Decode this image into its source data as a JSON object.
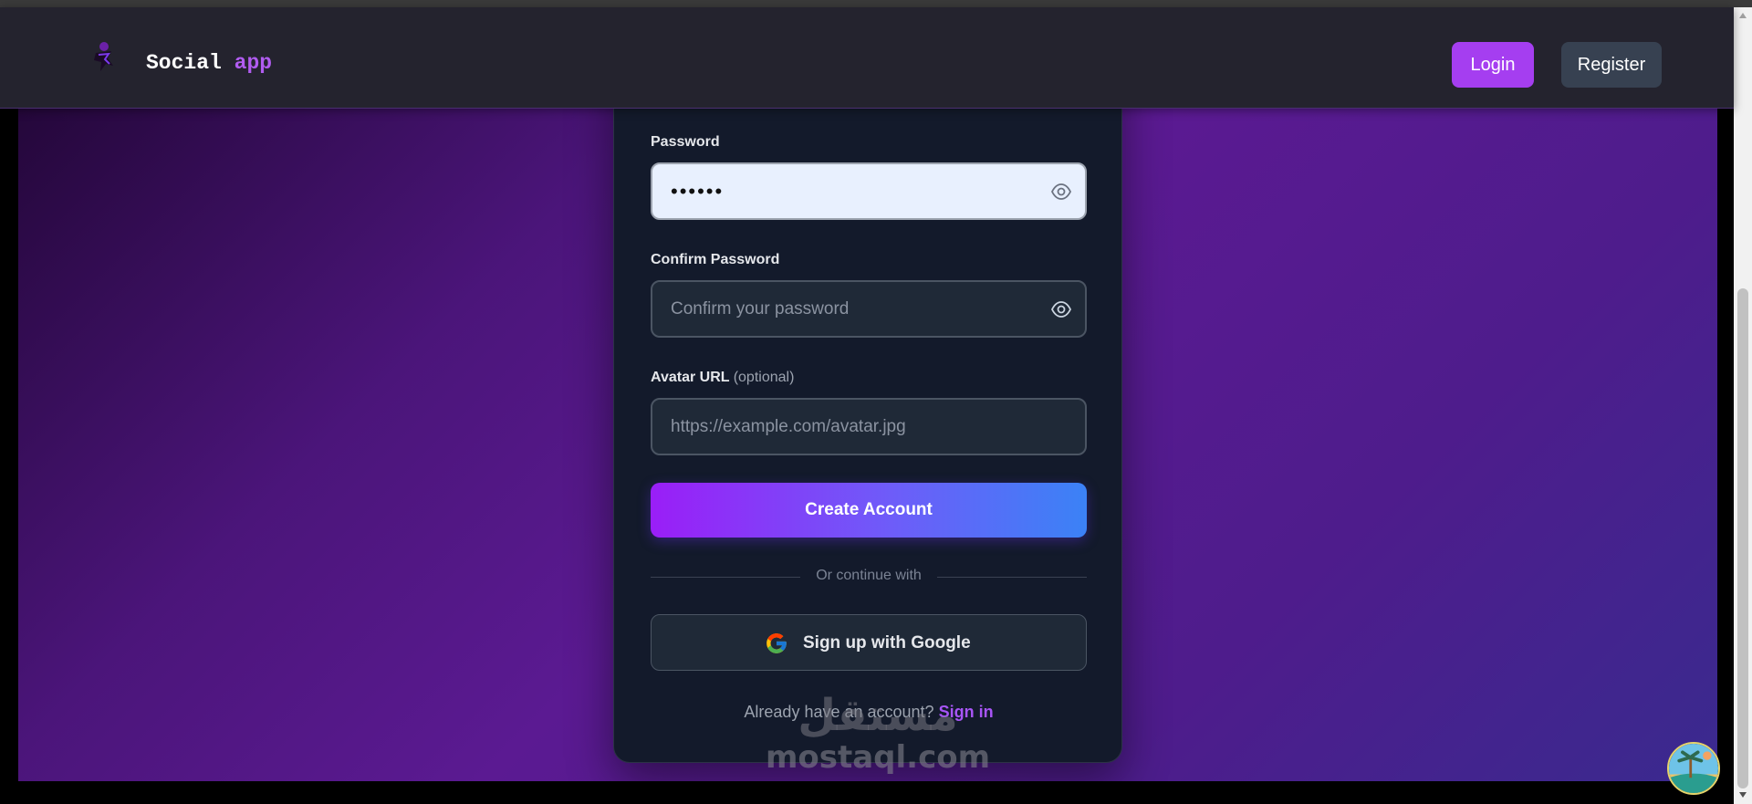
{
  "nav": {
    "brand_main": "Social",
    "brand_accent": "app",
    "login_label": "Login",
    "register_label": "Register"
  },
  "form": {
    "password": {
      "label": "Password",
      "value": "••••••"
    },
    "confirm_password": {
      "label": "Confirm Password",
      "placeholder": "Confirm your password",
      "value": ""
    },
    "avatar_url": {
      "label": "Avatar URL",
      "optional_note": "(optional)",
      "placeholder": "https://example.com/avatar.jpg",
      "value": ""
    },
    "submit_label": "Create Account",
    "divider_text": "Or continue with",
    "google_label": "Sign up with Google",
    "signin_prompt": "Already have an account?",
    "signin_link": "Sign in"
  },
  "watermark": {
    "arabic": "مستقل",
    "latin": "mostaql.com"
  },
  "colors": {
    "accent_purple": "#a53ef0",
    "nav_background": "#24232e",
    "card_background": "#131a2b",
    "button_gradient_start": "#9a1ef7",
    "button_gradient_end": "#3b82f6",
    "link_color": "#a855f7"
  },
  "icons": {
    "logo": "social-app-logo",
    "password_toggle": "eye-icon",
    "google": "google-icon"
  }
}
